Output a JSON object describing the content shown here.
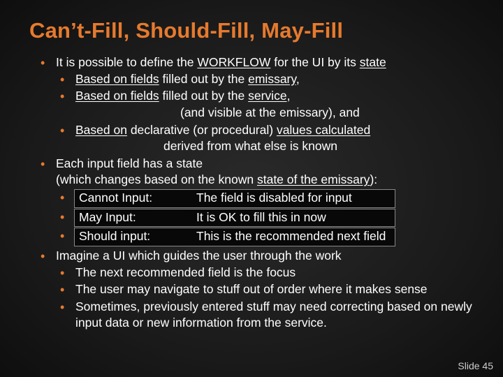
{
  "title": "Can’t-Fill, Should-Fill, May-Fill",
  "b1": {
    "pre1": "It is possible to define the ",
    "u1": "WORKFLOW",
    "mid1": " for the UI by its ",
    "u2": "state",
    "s1": {
      "pre": "",
      "u": "Based on fields",
      "mid": " filled out by the ",
      "u2": "emissary",
      "post": ","
    },
    "s2": {
      "u": "Based on fields",
      "mid": " filled out by the ",
      "u2": "service",
      "post": ",",
      "cont": "(and visible at the emissary),  and"
    },
    "s3": {
      "u1": "Based on",
      "mid": " declarative (or procedural) ",
      "u2": "values calculated",
      "cont": "derived from what else is known"
    }
  },
  "b2": {
    "l1": "Each input field has a state",
    "l2_pre": "(which changes based on the known ",
    "l2_u": "state of the emissary",
    "l2_post": "):",
    "rows": [
      {
        "label": "Cannot Input:",
        "desc": "The field is disabled for input"
      },
      {
        "label": "May Input:",
        "desc": "It is OK to fill this in now"
      },
      {
        "label": "Should input:",
        "desc": "This is the recommended next field"
      }
    ]
  },
  "b3": {
    "main": "Imagine a UI which guides the user through the work",
    "s1": "The next recommended field is the focus",
    "s2": "The user may navigate to stuff out of order where it makes sense",
    "s3": "Sometimes, previously entered stuff may need correcting based on newly input data or new information from the service."
  },
  "footer": "Slide 45"
}
